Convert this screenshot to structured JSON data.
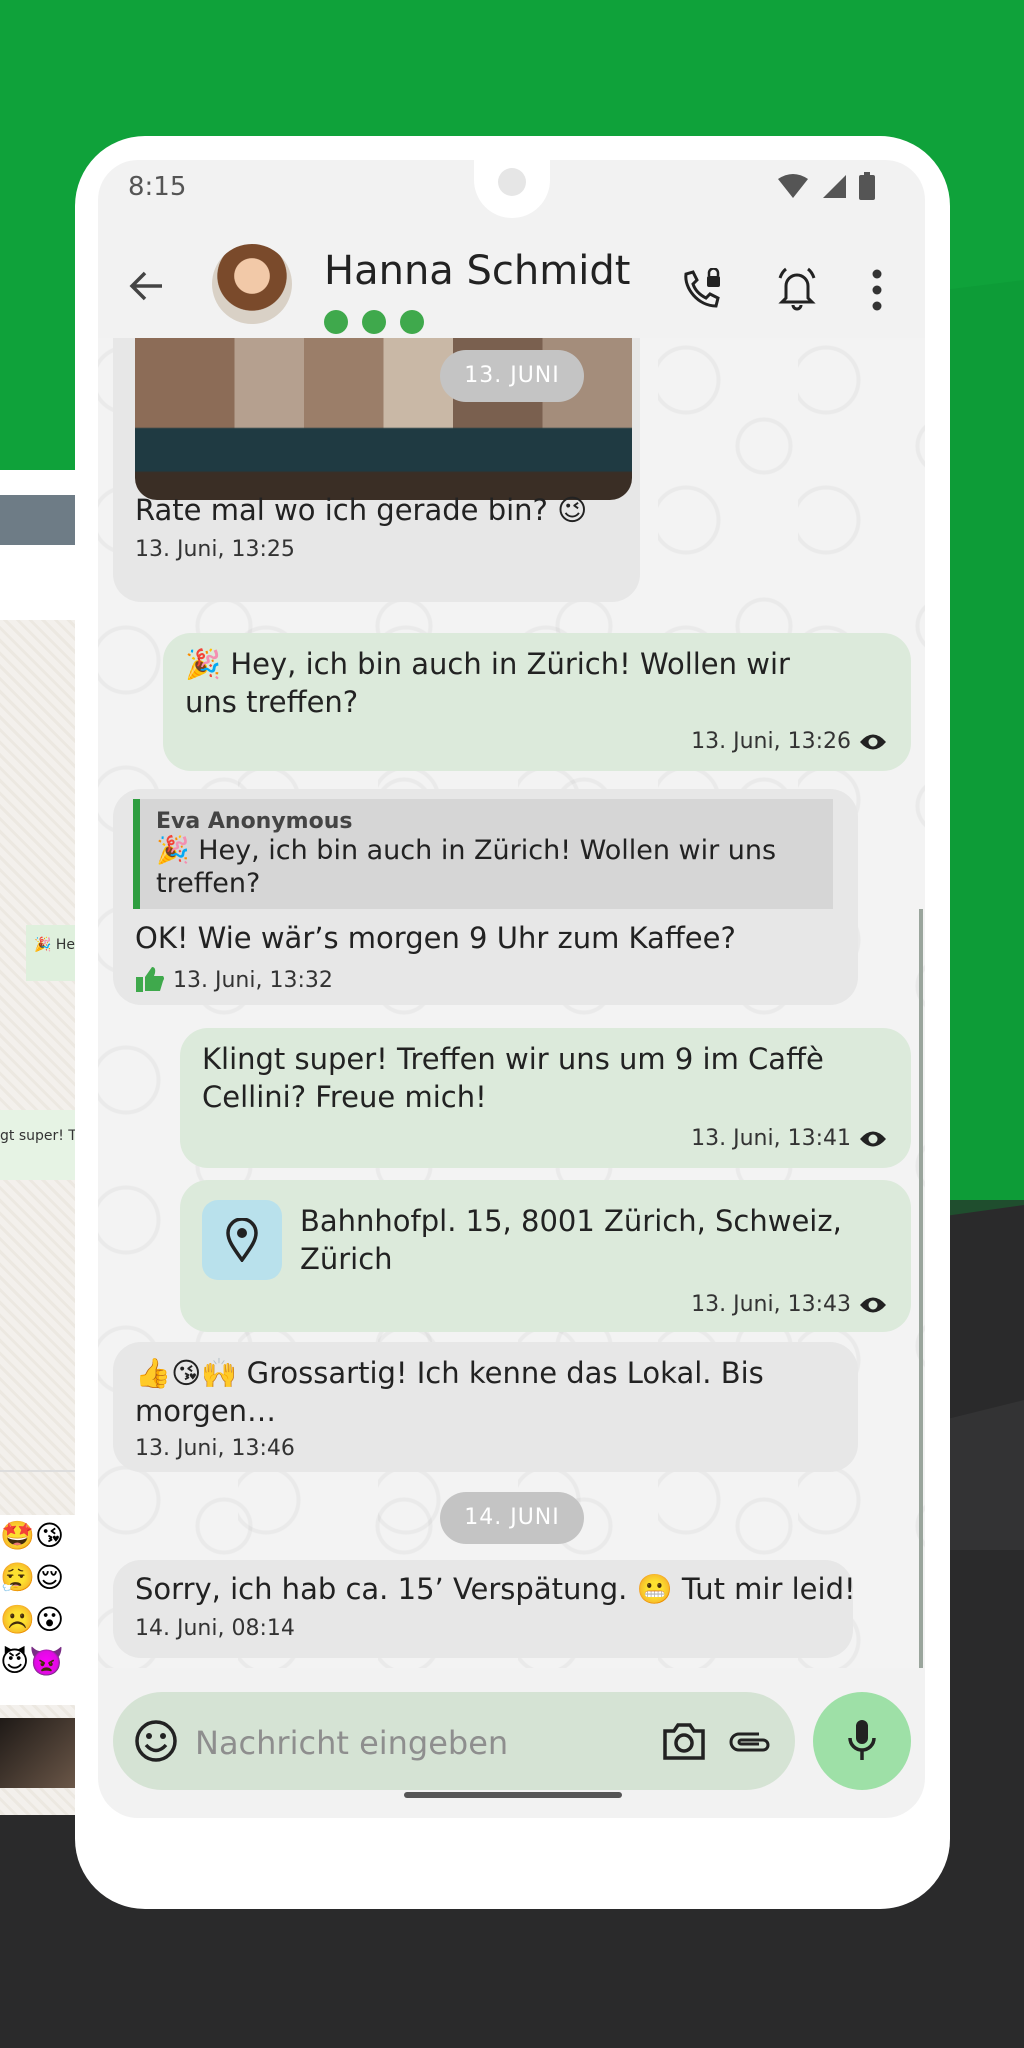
{
  "status": {
    "time": "8:15"
  },
  "header": {
    "contact_name": "Hanna Schmidt"
  },
  "messages": {
    "m1": {
      "date_pill": "13. JUNI",
      "text": "Rate mal wo ich gerade bin? 😉",
      "time": "13. Juni, 13:25"
    },
    "m2": {
      "text": "🎉 Hey, ich bin auch in Zürich! Wollen wir uns treffen?",
      "time": "13. Juni, 13:26"
    },
    "m3": {
      "quote_author": "Eva Anonymous",
      "quote_text": "🎉 Hey, ich bin auch in Zürich! Wollen wir uns treffen?",
      "text": "OK! Wie wär’s morgen 9 Uhr zum Kaffee?",
      "time": "13. Juni, 13:32"
    },
    "m4": {
      "text": "Klingt super! Treffen wir uns um 9 im Caffè Cellini? Freue mich!",
      "time": "13. Juni, 13:41"
    },
    "m5": {
      "location": "Bahnhofpl. 15, 8001 Zürich, Schweiz, Zürich",
      "time": "13. Juni, 13:43"
    },
    "m6": {
      "text": "👍😘🙌 Grossartig! Ich kenne das Lokal. Bis morgen…",
      "time": "13. Juni, 13:46"
    },
    "date2": "14. JUNI",
    "m7": {
      "text": "Sorry, ich hab ca. 15’ Verspätung. 😬 Tut mir leid!",
      "time": "14. Juni, 08:14"
    }
  },
  "input": {
    "placeholder": "Nachricht eingeben"
  },
  "behind": {
    "bubble1": "🎉 He",
    "bubble2": "gt super! Tr",
    "emojis": "🤩😘\n😮‍💨😌\n☹️😮\n😈👿"
  },
  "colors": {
    "accent_green": "#0fa23a",
    "outgoing_bubble": "#dceadb",
    "incoming_bubble": "#e7e7e7",
    "mic_button": "#9ee0a7"
  }
}
